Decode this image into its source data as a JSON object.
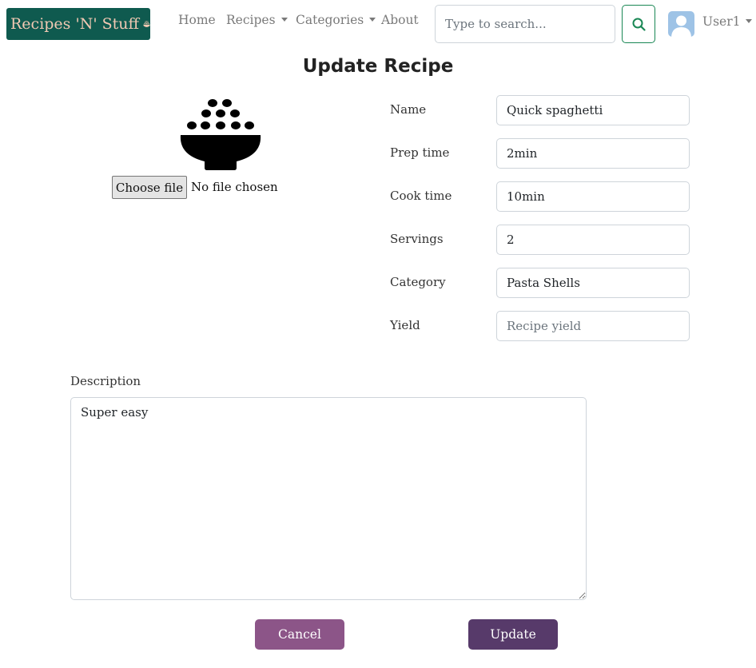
{
  "navbar": {
    "brand": "Recipes 'N' Stuff",
    "links": {
      "home": "Home",
      "recipes": "Recipes",
      "categories": "Categories",
      "about": "About"
    },
    "search_placeholder": "Type to search...",
    "user_name": "User1"
  },
  "page": {
    "title": "Update Recipe"
  },
  "image_upload": {
    "button_label": "Choose file",
    "status": "No file chosen"
  },
  "form": {
    "name": {
      "label": "Name",
      "value": "Quick spaghetti"
    },
    "prep_time": {
      "label": "Prep time",
      "value": "2min"
    },
    "cook_time": {
      "label": "Cook time",
      "value": "10min"
    },
    "servings": {
      "label": "Servings",
      "value": "2"
    },
    "category": {
      "label": "Category",
      "value": "Pasta Shells"
    },
    "yield": {
      "label": "Yield",
      "value": "",
      "placeholder": "Recipe yield"
    },
    "description": {
      "label": "Description",
      "value": "Super easy"
    }
  },
  "actions": {
    "cancel": "Cancel",
    "update": "Update"
  },
  "icons": {
    "brand": "rice-bowl-icon",
    "search": "search-icon",
    "avatar": "user-avatar-icon",
    "recipe_image": "rice-bowl-icon"
  },
  "colors": {
    "brand_bg": "#0f5a4f",
    "brand_text": "#f2c9b3",
    "search_accent": "#198754",
    "cancel_button": "#8c5588",
    "update_button": "#573a6a"
  }
}
